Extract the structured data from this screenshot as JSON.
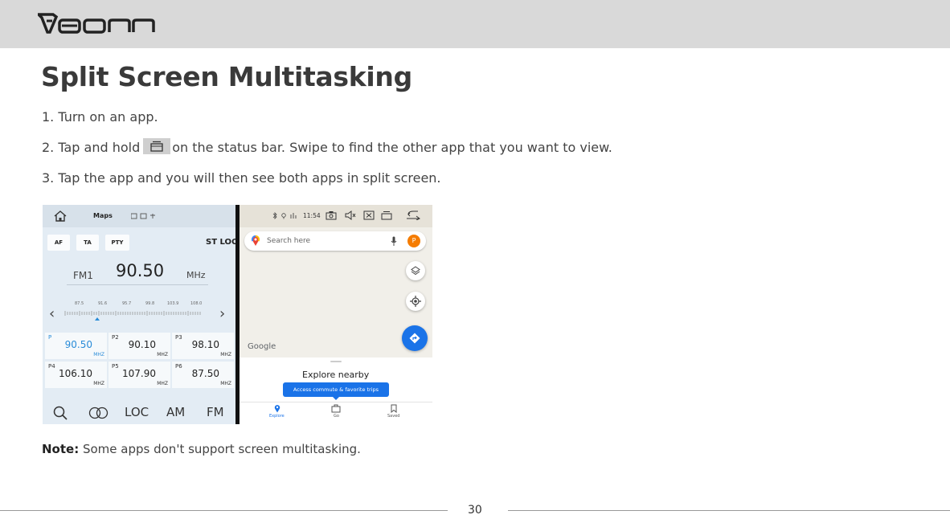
{
  "brand": {
    "logo_text": "EONON"
  },
  "title": "Split Screen Multitasking",
  "steps": [
    "1. Turn on an app.",
    {
      "before": "2. Tap and hold",
      "after": "on the status bar. Swipe to find the other app that you want to view."
    },
    "3. Tap the app and you will then see both apps in split screen."
  ],
  "radio": {
    "app_title": "Maps",
    "chips": [
      "AF",
      "TA",
      "PTY"
    ],
    "st_loc": "ST LOC",
    "band": "FM1",
    "frequency": "90.50",
    "unit": "MHz",
    "scale": [
      "87.5",
      "91.6",
      "95.7",
      "99.8",
      "103.9",
      "108.0"
    ],
    "presets": [
      {
        "label": "P",
        "freq": "90.50",
        "unit": "MHZ"
      },
      {
        "label": "P2",
        "freq": "90.10",
        "unit": "MHZ"
      },
      {
        "label": "P3",
        "freq": "98.10",
        "unit": "MHZ"
      },
      {
        "label": "P4",
        "freq": "106.10",
        "unit": "MHZ"
      },
      {
        "label": "P5",
        "freq": "107.90",
        "unit": "MHZ"
      },
      {
        "label": "P6",
        "freq": "87.50",
        "unit": "MHZ"
      }
    ],
    "bottom": [
      "LOC",
      "AM",
      "FM"
    ]
  },
  "maps": {
    "time": "11:54",
    "search_placeholder": "Search here",
    "avatar_letter": "P",
    "google": "Google",
    "explore": "Explore nearby",
    "tooltip": "Access commute & favorite trips",
    "nav": [
      "Explore",
      "Go",
      "Saved"
    ]
  },
  "note": {
    "label": "Note:",
    "text": "Some apps don't support screen multitasking."
  },
  "page_number": "30",
  "colors": {
    "header": "#d9d9d9",
    "accent": "#1a73e8",
    "radio_active": "#2a8cd8"
  }
}
